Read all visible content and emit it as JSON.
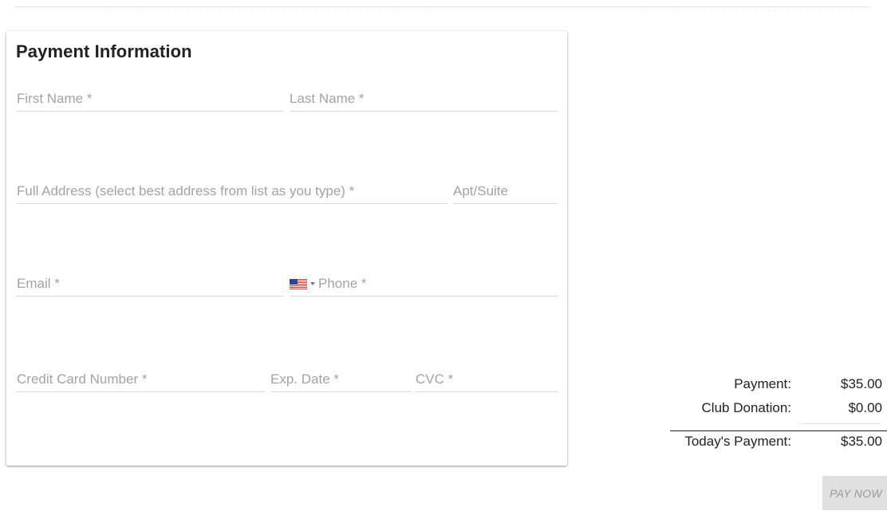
{
  "card": {
    "title": "Payment Information"
  },
  "form": {
    "first_name": {
      "placeholder": "First Name *",
      "value": ""
    },
    "last_name": {
      "placeholder": "Last Name *",
      "value": ""
    },
    "full_address": {
      "placeholder": "Full Address (select best address from list as you type) *",
      "value": ""
    },
    "apt_suite": {
      "placeholder": "Apt/Suite",
      "value": ""
    },
    "email": {
      "placeholder": "Email *",
      "value": ""
    },
    "phone": {
      "placeholder": "Phone *",
      "value": "",
      "country_icon": "us-flag-icon"
    },
    "card_number": {
      "placeholder": "Credit Card Number *",
      "value": ""
    },
    "exp_date": {
      "placeholder": "Exp. Date *",
      "value": ""
    },
    "cvc": {
      "placeholder": "CVC *",
      "value": ""
    }
  },
  "summary": {
    "payment_label": "Payment:",
    "payment_value": "$35.00",
    "donation_label": "Club Donation:",
    "donation_value": "$0.00",
    "total_label": "Today's Payment:",
    "total_value": "$35.00"
  },
  "actions": {
    "pay_now_label": "PAY NOW",
    "pay_now_disabled": true
  },
  "colors": {
    "placeholder": "#a3a3a3",
    "underline": "#d9d9d9",
    "button_bg": "#e0e0e0",
    "button_text": "#9a9a9a"
  }
}
